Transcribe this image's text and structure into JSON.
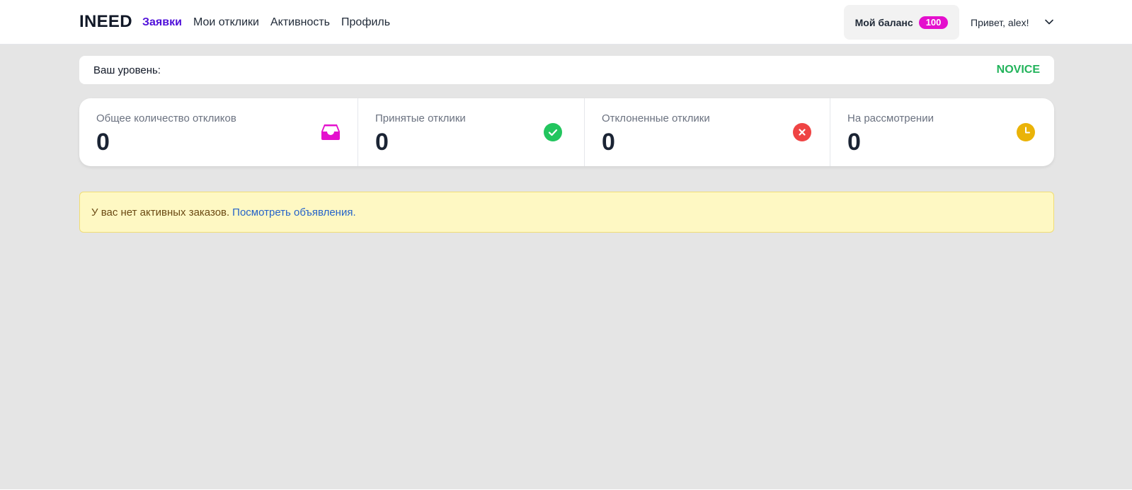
{
  "header": {
    "brand": "INEED",
    "nav": [
      {
        "label": "Заявки",
        "active": true
      },
      {
        "label": "Мои отклики",
        "active": false
      },
      {
        "label": "Активность",
        "active": false
      },
      {
        "label": "Профиль",
        "active": false
      }
    ],
    "balance_label": "Мой баланс",
    "balance_value": "100",
    "greeting": "Привет, alex!",
    "menu_icon": "chevron-down-icon"
  },
  "level": {
    "label": "Ваш уровень:",
    "value": "NOVICE"
  },
  "stats": [
    {
      "title": "Общее количество откликов",
      "value": "0",
      "icon": "inbox-icon",
      "color": "#e40fcd"
    },
    {
      "title": "Принятые отклики",
      "value": "0",
      "icon": "check-circle-icon",
      "color": "#22c55e"
    },
    {
      "title": "Отклоненные отклики",
      "value": "0",
      "icon": "x-circle-icon",
      "color": "#ef4444"
    },
    {
      "title": "На рассмотрении",
      "value": "0",
      "icon": "clock-icon",
      "color": "#eab308"
    }
  ],
  "alert": {
    "text": "У вас нет активных заказов.",
    "link": "Посмотреть объявления."
  },
  "colors": {
    "accent": "#4f0fd9",
    "badge": "#e40fcd",
    "level": "#21b35a"
  }
}
